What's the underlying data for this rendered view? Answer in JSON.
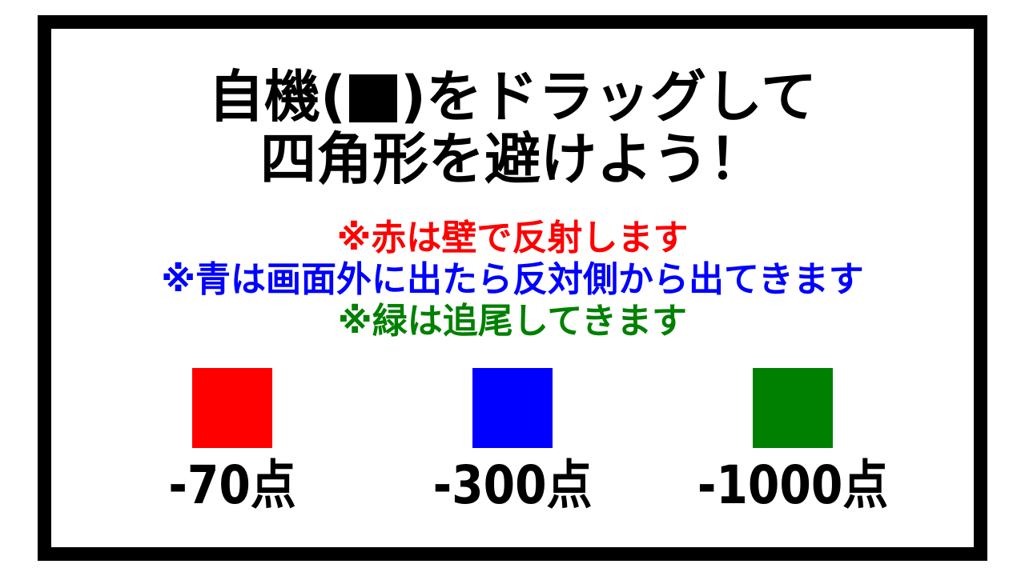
{
  "title": {
    "line1_before": "自機(",
    "line1_after": ")をドラッグして",
    "line2": "四角形を避けよう！",
    "player_color": "#000000"
  },
  "notes": [
    {
      "text": "※赤は壁で反射します",
      "color": "#ff0000"
    },
    {
      "text": "※青は画面外に出たら反対側から出てきます",
      "color": "#0000ff"
    },
    {
      "text": "※緑は追尾してきます",
      "color": "#008000"
    }
  ],
  "enemies": [
    {
      "name": "red",
      "color": "#ff0000",
      "score": "-70点"
    },
    {
      "name": "blue",
      "color": "#0000ff",
      "score": "-300点"
    },
    {
      "name": "green",
      "color": "#008000",
      "score": "-1000点"
    }
  ]
}
